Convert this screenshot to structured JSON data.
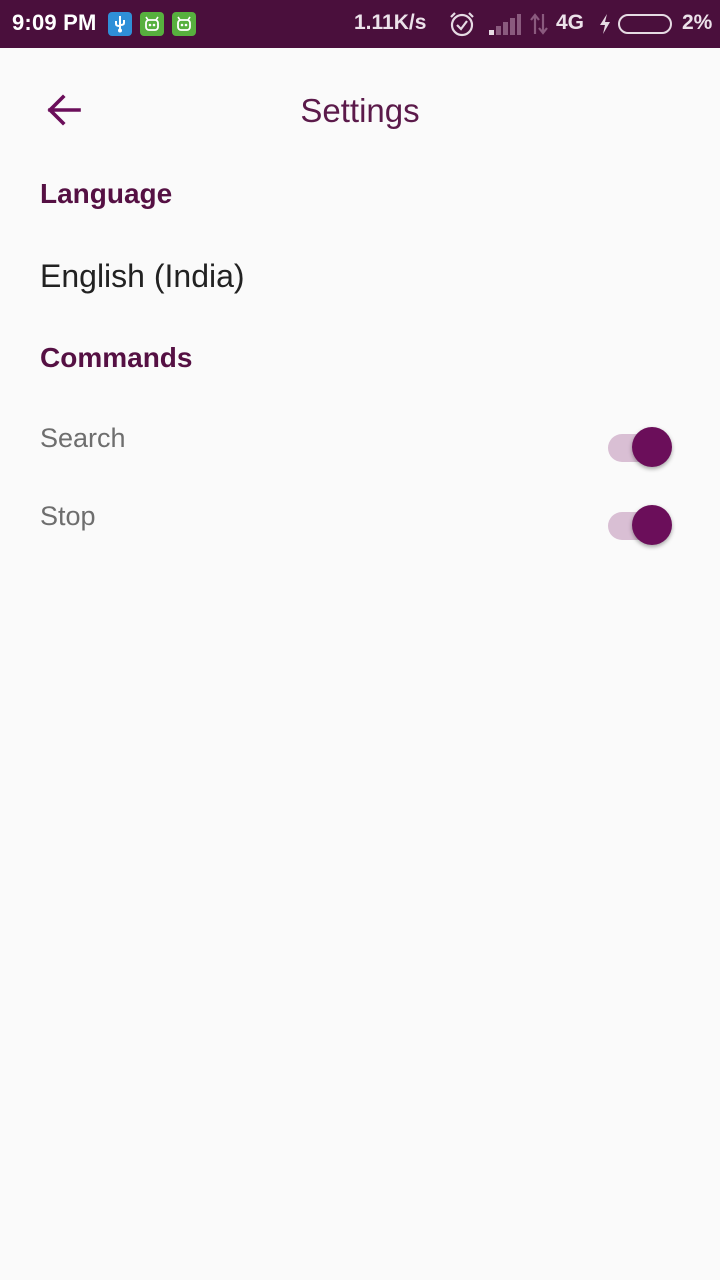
{
  "status_bar": {
    "time": "9:09 PM",
    "notification_icons": [
      "usb-icon",
      "android-icon",
      "android-icon"
    ],
    "net_speed": "1.11K/s",
    "network_type": "4G",
    "battery_level": "2%",
    "background_color": "#4a0f3c"
  },
  "header": {
    "back_icon": "arrow-left-icon",
    "title": "Settings"
  },
  "sections": {
    "language": {
      "title": "Language",
      "value": "English (India)"
    },
    "commands": {
      "title": "Commands",
      "items": [
        {
          "label": "Search",
          "enabled": true
        },
        {
          "label": "Stop",
          "enabled": true
        }
      ]
    }
  },
  "colors": {
    "accent": "#6b0e5a",
    "section_title": "#551043",
    "toggle_track_on": "#d9bfd4",
    "background": "#fafafa"
  }
}
